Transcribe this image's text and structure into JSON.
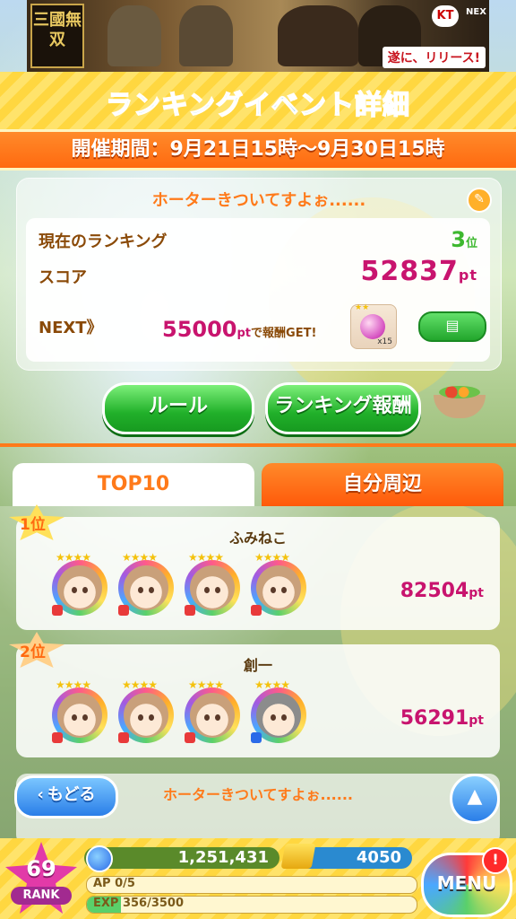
{
  "banner": {
    "logo_text": "三國無双",
    "kt_label": "KT",
    "nex_label": "NEX",
    "release_text": "遂に、リリース!"
  },
  "header": {
    "title": "ランキングイベント詳細",
    "period": "開催期間：9月21日15時〜9月30日15時"
  },
  "info_panel": {
    "event_name": "ホーターきついてすよぉ......",
    "current_rank_label": "現在のランキング",
    "current_rank_value": "3",
    "rank_unit": "位",
    "score_label": "スコア",
    "score_value": "52837",
    "pt_unit": "pt",
    "next_label": "NEXT》",
    "next_points": "55000",
    "next_suffix": "で報酬GET!",
    "reward_count": "x15",
    "reward_stars": "★★",
    "memo_icon": "document-icon"
  },
  "buttons": {
    "rules": "ルール",
    "ranking_rewards": "ランキング報酬"
  },
  "tabs": {
    "top10": "TOP10",
    "around_me": "自分周辺"
  },
  "rankings": [
    {
      "rank_label": "1位",
      "name": "ふみねこ",
      "points": "82504",
      "avatars": [
        "★★★★",
        "★★★★",
        "★★★★",
        "★★★★"
      ]
    },
    {
      "rank_label": "2位",
      "name": "創一",
      "points": "56291",
      "avatars": [
        "★★★★",
        "★★★★",
        "★★★★",
        "★★★★"
      ]
    }
  ],
  "bottom_nav": {
    "back": "もどる",
    "current_event": "ホーターきついてすよぉ......"
  },
  "status": {
    "rank": "69",
    "rank_label": "RANK",
    "coins": "1,251,431",
    "gems": "4050",
    "ap": "AP  0/5",
    "exp": "EXP 356/3500",
    "exp_fraction": 0.102,
    "menu": "MENU",
    "notification": "!"
  },
  "colors": {
    "accent_orange": "#ff7a1a",
    "score_pink": "#c8146e",
    "button_green": "#21b02a"
  }
}
